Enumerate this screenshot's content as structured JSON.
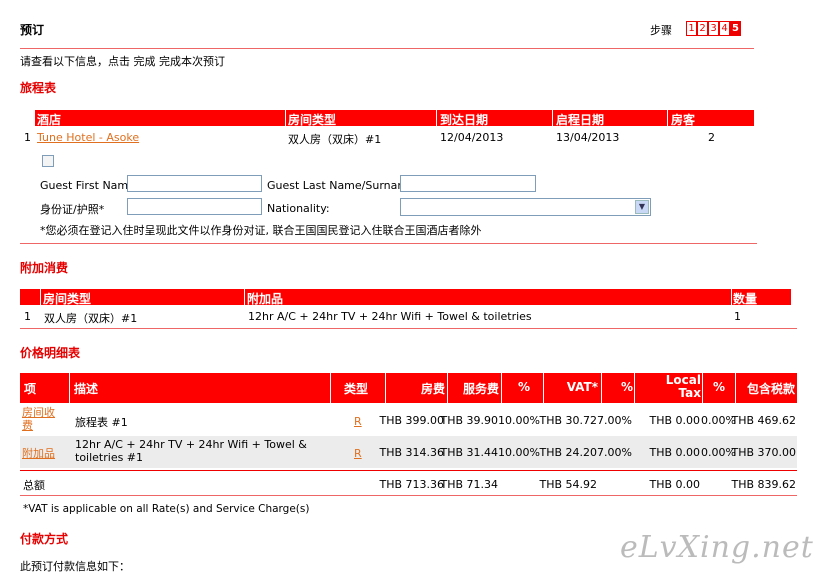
{
  "header": {
    "title": "预订",
    "steps_label": "步骤",
    "steps": [
      "1",
      "2",
      "3",
      "4",
      "5"
    ],
    "current_step": "5",
    "instruction": "请查看以下信息，点击 完成 完成本次预订"
  },
  "itinerary": {
    "section_title": "旅程表",
    "columns": [
      "酒店",
      "房间类型",
      "到达日期",
      "启程日期",
      "房客"
    ],
    "row": {
      "index": "1",
      "hotel": "Tune Hotel - Asoke",
      "room_type": "双人房（双床）#1",
      "arrival": "12/04/2013",
      "departure": "13/04/2013",
      "guests": "2"
    },
    "form": {
      "first_name_label": "Guest First Name",
      "last_name_label": "Guest Last Name/Surname",
      "id_label": "身份证/护照*",
      "nationality_label": "Nationality:",
      "first_name_value": "",
      "last_name_value": "",
      "id_value": "",
      "nationality_value": "",
      "note": "*您必须在登记入住时呈现此文件以作身份对证, 联合王国国民登记入住联合王国酒店者除外"
    }
  },
  "addons": {
    "section_title": "附加消费",
    "columns": [
      "房间类型",
      "附加品",
      "数量"
    ],
    "row": {
      "index": "1",
      "room_type": "双人房（双床）#1",
      "item": "12hr A/C + 24hr TV + 24hr Wifi + Towel & toiletries",
      "qty": "1"
    }
  },
  "pricing": {
    "section_title": "价格明细表",
    "columns": {
      "item": "项",
      "desc": "描述",
      "type": "类型",
      "room": "房费",
      "service": "服务费",
      "pct1": "%",
      "vat": "VAT*",
      "pct2": "%",
      "local_tax": "Local Tax",
      "pct3": "%",
      "total": "包含税款"
    },
    "rows": [
      {
        "item": "房间收费",
        "desc": "旅程表 #1",
        "type": "R",
        "room": "THB 399.00",
        "service": "THB 39.90",
        "pct1": "10.00%",
        "vat": "THB 30.72",
        "pct2": "7.00%",
        "local_tax": "THB 0.00",
        "pct3": "0.00%",
        "total": "THB 469.62"
      },
      {
        "item": "附加品",
        "desc": "12hr A/C + 24hr TV + 24hr Wifi + Towel & toiletries #1",
        "type": "R",
        "room": "THB 314.36",
        "service": "THB 31.44",
        "pct1": "10.00%",
        "vat": "THB 24.20",
        "pct2": "7.00%",
        "local_tax": "THB 0.00",
        "pct3": "0.00%",
        "total": "THB 370.00"
      }
    ],
    "totals": {
      "label": "总额",
      "room": "THB 713.36",
      "service": "THB 71.34",
      "vat": "THB 54.92",
      "local_tax": "THB 0.00",
      "total": "THB 839.62"
    },
    "vat_note": "*VAT is applicable on all Rate(s) and Service Charge(s)"
  },
  "payment": {
    "section_title": "付款方式",
    "intro": "此预订付款信息如下："
  },
  "watermark": "eLvXing.net",
  "colors": {
    "accent": "#ff0000",
    "link": "#e07020"
  }
}
